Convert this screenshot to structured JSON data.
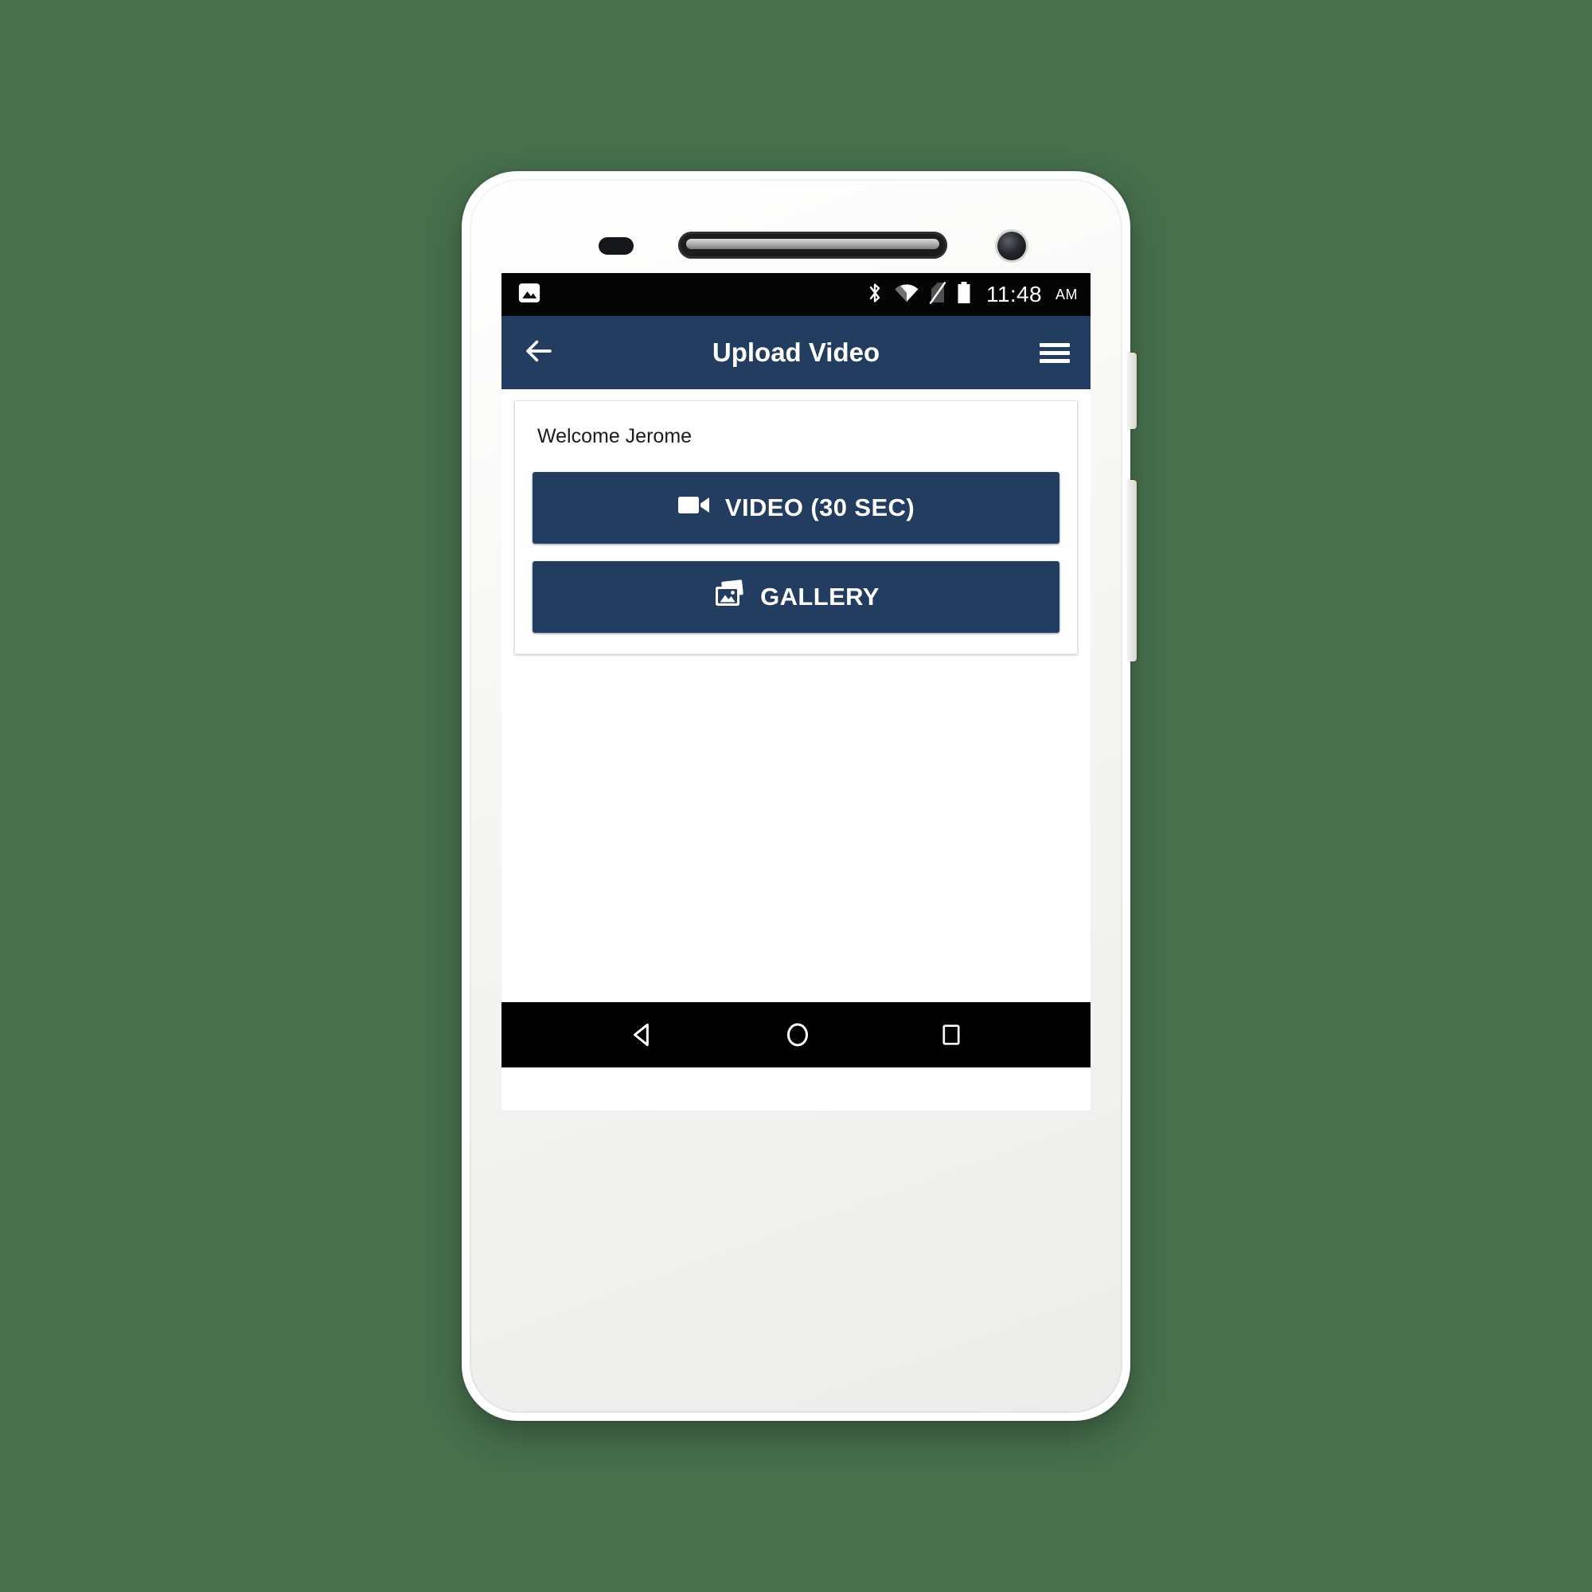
{
  "background": {
    "color": "#47704d"
  },
  "device": {
    "body_color": "#ffffff",
    "hardware": {
      "proximity_sensor": "proximity-sensor",
      "earpiece": "earpiece-speaker",
      "front_camera": "front-camera",
      "power_button": "power-button",
      "volume_button": "volume-button"
    }
  },
  "status_bar": {
    "background": "#050505",
    "left_icons": [
      {
        "name": "screenshot-image-icon",
        "label": "image"
      }
    ],
    "right_icons": [
      {
        "name": "bluetooth-icon",
        "label": "bluetooth"
      },
      {
        "name": "wifi-icon",
        "label": "wifi"
      },
      {
        "name": "no-sim-icon",
        "label": "no signal"
      },
      {
        "name": "battery-icon",
        "label": "battery"
      }
    ],
    "time": "11:48",
    "ampm": "AM"
  },
  "app_bar": {
    "background": "#233d60",
    "title": "Upload Video",
    "back_icon": "arrow-back-icon",
    "menu_icon": "hamburger-menu-icon"
  },
  "content": {
    "card": {
      "welcome_text": "Welcome Jerome",
      "buttons": [
        {
          "id": "video",
          "label": "VIDEO (30 SEC)",
          "icon": "videocam-icon",
          "color": "#233d60"
        },
        {
          "id": "gallery",
          "label": "GALLERY",
          "icon": "photo-library-icon",
          "color": "#233d60"
        }
      ]
    }
  },
  "nav_bar": {
    "background": "#000000",
    "keys": [
      {
        "name": "nav-back-key",
        "label": "Back"
      },
      {
        "name": "nav-home-key",
        "label": "Home"
      },
      {
        "name": "nav-recents-key",
        "label": "Recents"
      }
    ]
  }
}
